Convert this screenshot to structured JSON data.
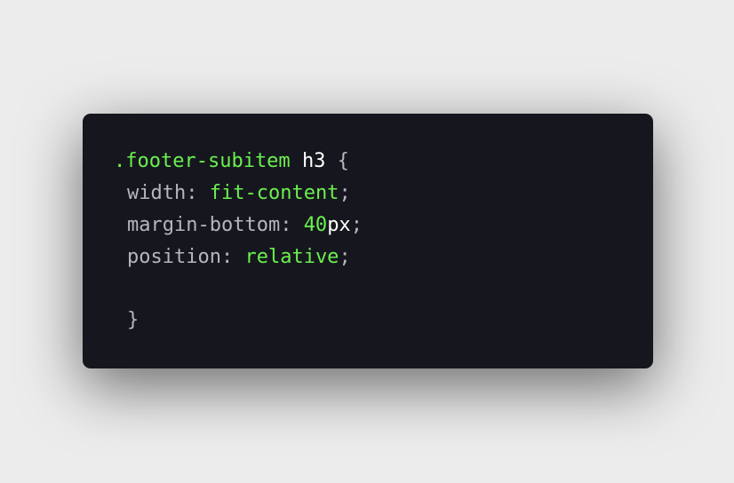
{
  "theme": {
    "page_background": "#ececec",
    "card_background": "#16171e",
    "selector_color": "#6af04f",
    "tag_color": "#ffffff",
    "property_color": "#b6b6bd",
    "value_color": "#6af04f",
    "number_color": "#6af04f",
    "unit_color": "#ffffff",
    "punctuation_color": "#b6b6bd"
  },
  "code": {
    "line1": {
      "selector": ".footer-subitem",
      "space": " ",
      "tag": "h3",
      "brace_open": " {"
    },
    "line2": {
      "property": "width",
      "colon": ": ",
      "value": "fit-content",
      "semicolon": ";"
    },
    "line3": {
      "property": "margin-bottom",
      "colon": ": ",
      "number": "40",
      "unit": "px",
      "semicolon": ";"
    },
    "line4": {
      "property": "position",
      "colon": ": ",
      "value": "relative",
      "semicolon": ";"
    },
    "line6": {
      "brace_close": "}"
    }
  }
}
